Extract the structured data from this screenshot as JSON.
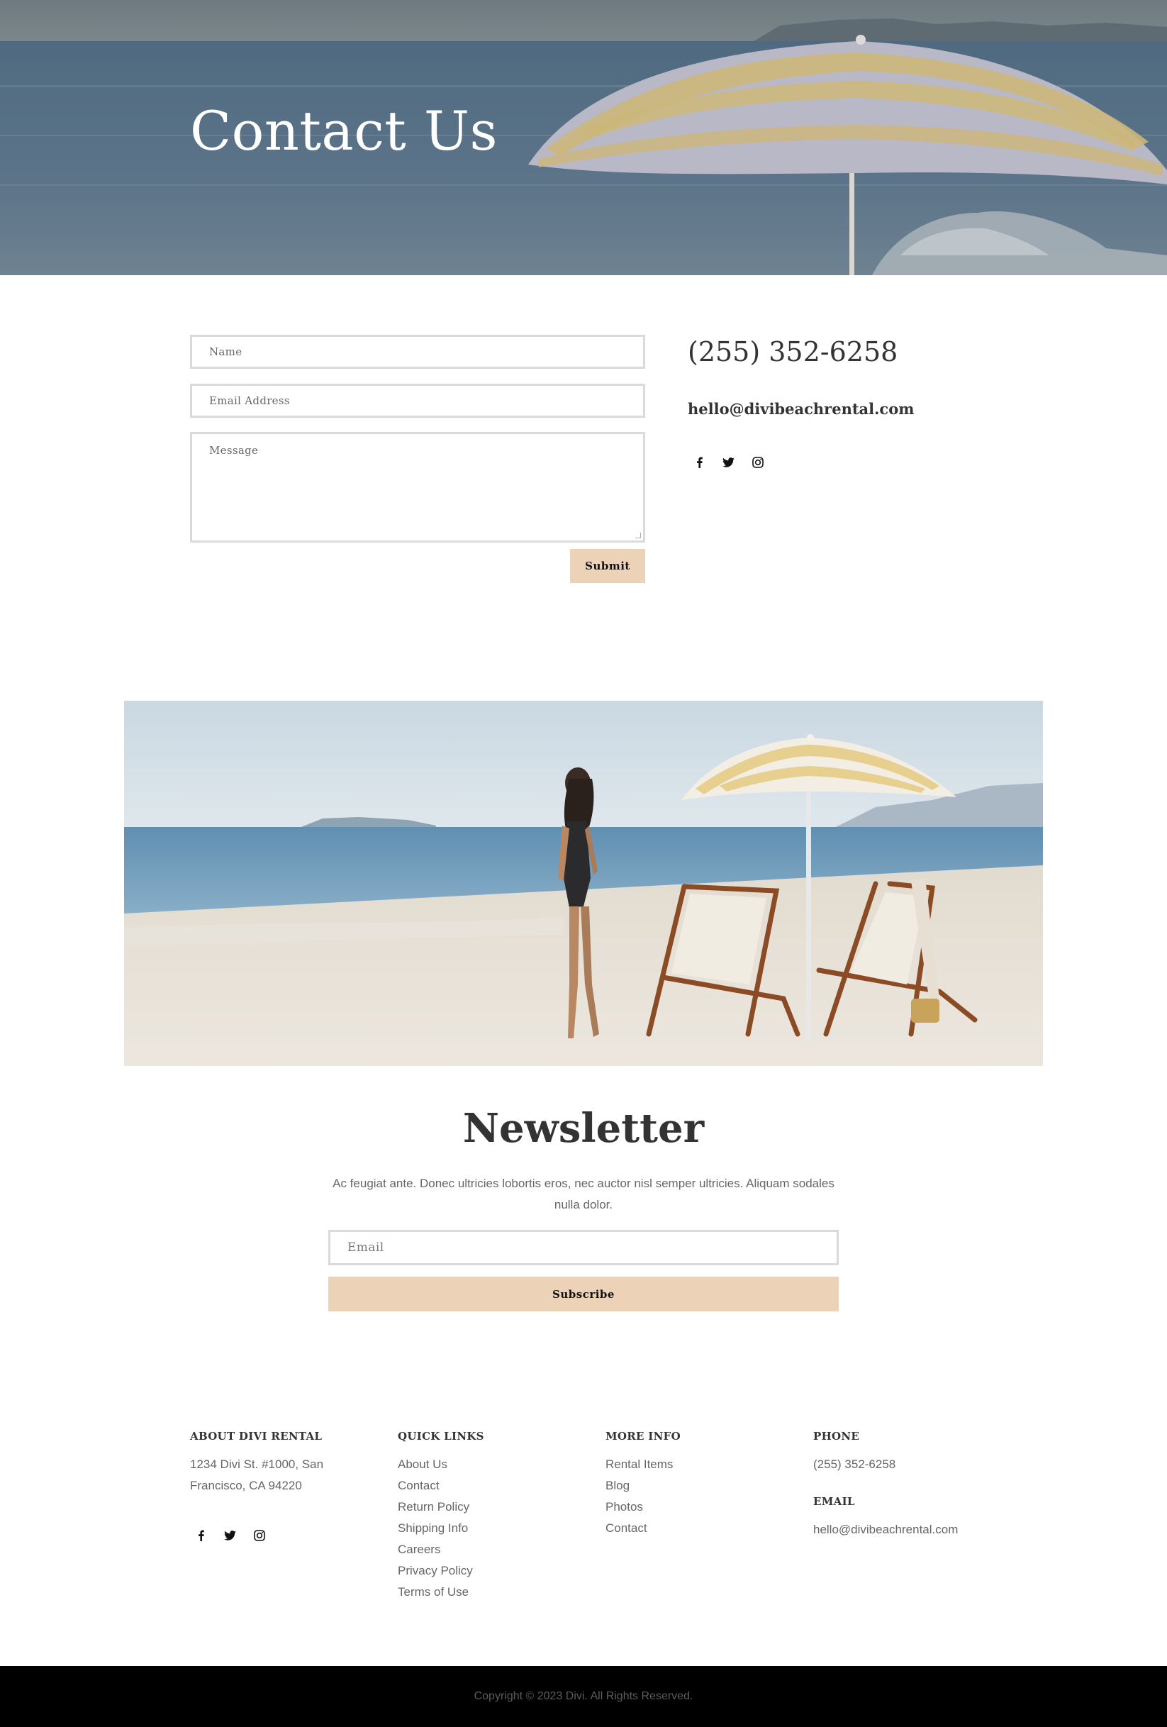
{
  "hero": {
    "title": "Contact Us"
  },
  "form": {
    "name_placeholder": "Name",
    "email_placeholder": "Email Address",
    "message_placeholder": "Message",
    "submit_label": "Submit"
  },
  "contact_info": {
    "phone": "(255) 352-6258",
    "email": "hello@divibeachrental.com",
    "social": [
      "facebook-icon",
      "twitter-icon",
      "instagram-icon"
    ]
  },
  "newsletter": {
    "title": "Newsletter",
    "text": "Ac feugiat ante. Donec ultricies lobortis eros, nec auctor nisl semper ultricies. Aliquam sodales nulla dolor.",
    "email_placeholder": "Email",
    "subscribe_label": "Subscribe"
  },
  "footer": {
    "about": {
      "heading": "ABOUT DIVI RENTAL",
      "address": "1234 Divi St. #1000, San Francisco, CA 94220"
    },
    "quick_links": {
      "heading": "QUICK LINKS",
      "items": [
        "About Us",
        "Contact",
        "Return Policy",
        "Shipping Info",
        "Careers",
        "Privacy Policy",
        "Terms of Use"
      ]
    },
    "more_info": {
      "heading": "MORE INFO",
      "items": [
        "Rental Items",
        "Blog",
        "Photos",
        "Contact"
      ]
    },
    "phone": {
      "heading": "PHONE",
      "value": "(255) 352-6258"
    },
    "email": {
      "heading": "EMAIL",
      "value": "hello@divibeachrental.com"
    },
    "copyright": "Copyright © 2023 Divi. All Rights Reserved."
  },
  "colors": {
    "accent": "#ecd3b8",
    "text_dark": "#333333",
    "text_muted": "#666666",
    "bottom_bar": "#000000"
  }
}
